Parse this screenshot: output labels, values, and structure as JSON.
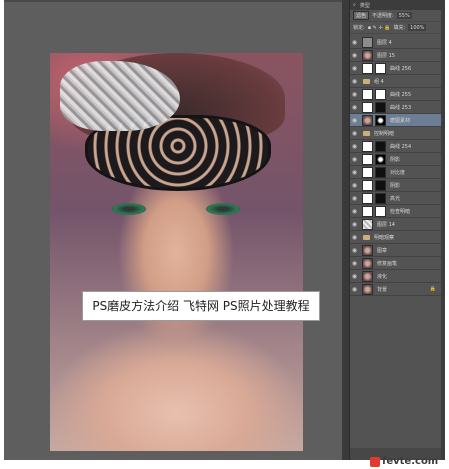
{
  "canvas": {
    "caption": "PS磨皮方法介绍 飞特网 PS照片处理教程"
  },
  "layers_panel": {
    "kind_label": "类型",
    "blend_mode": "滤色",
    "opacity_label": "不透明度:",
    "opacity_value": "55%",
    "lock_label": "锁定:",
    "fill_label": "填充:",
    "fill_value": "100%",
    "layers": [
      {
        "name": "图层 4",
        "thumb": "plain",
        "mask": "",
        "active": false,
        "folder": false
      },
      {
        "name": "图层 15",
        "thumb": "face",
        "mask": "",
        "active": false,
        "folder": false
      },
      {
        "name": "曲线 256",
        "thumb": "white",
        "mask": "white",
        "active": false,
        "folder": false
      },
      {
        "name": "组 4",
        "thumb": "",
        "mask": "",
        "active": false,
        "folder": true
      },
      {
        "name": "曲线 255",
        "thumb": "white",
        "mask": "white",
        "active": false,
        "folder": false
      },
      {
        "name": "曲线 253",
        "thumb": "white",
        "mask": "black",
        "active": false,
        "folder": false
      },
      {
        "name": "磨图素材",
        "thumb": "face",
        "mask": "dark",
        "active": true,
        "folder": false
      },
      {
        "name": "控制明暗",
        "thumb": "",
        "mask": "",
        "active": false,
        "folder": true
      },
      {
        "name": "曲线 254",
        "thumb": "white",
        "mask": "black",
        "active": false,
        "folder": false
      },
      {
        "name": "阴影",
        "thumb": "white",
        "mask": "dark",
        "active": false,
        "folder": false
      },
      {
        "name": "对比度",
        "thumb": "white",
        "mask": "black",
        "active": false,
        "folder": false
      },
      {
        "name": "阴影",
        "thumb": "white",
        "mask": "black",
        "active": false,
        "folder": false
      },
      {
        "name": "高光",
        "thumb": "white",
        "mask": "black",
        "active": false,
        "folder": false
      },
      {
        "name": "检查明暗",
        "thumb": "white",
        "mask": "white",
        "active": false,
        "folder": false
      },
      {
        "name": "图层 14",
        "thumb": "checker",
        "mask": "",
        "active": false,
        "folder": false
      },
      {
        "name": "明暗观察",
        "thumb": "",
        "mask": "",
        "active": false,
        "folder": true
      },
      {
        "name": "图章",
        "thumb": "face",
        "mask": "",
        "active": false,
        "folder": false
      },
      {
        "name": "修复画笔",
        "thumb": "face",
        "mask": "",
        "active": false,
        "folder": false
      },
      {
        "name": "液化",
        "thumb": "face",
        "mask": "",
        "active": false,
        "folder": false
      },
      {
        "name": "背景",
        "thumb": "face",
        "mask": "",
        "active": false,
        "folder": false,
        "locked": true
      }
    ]
  },
  "watermark": "fevte.com"
}
